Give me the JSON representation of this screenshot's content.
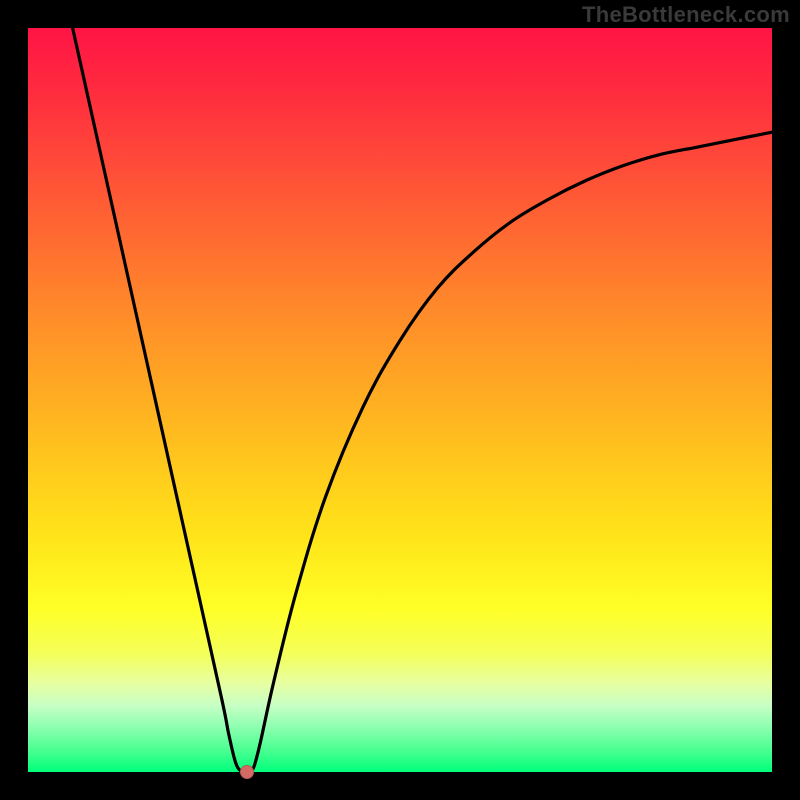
{
  "watermark": {
    "text": "TheBottleneck.com"
  },
  "chart_data": {
    "type": "line",
    "title": "",
    "xlabel": "",
    "ylabel": "",
    "xlim": [
      0,
      100
    ],
    "ylim": [
      0,
      100
    ],
    "grid": false,
    "legend": false,
    "series": [
      {
        "name": "bottleneck-curve",
        "color": "#000000",
        "x": [
          6,
          10,
          14,
          18,
          22,
          26,
          27,
          28,
          29,
          30,
          31,
          33,
          36,
          40,
          45,
          50,
          55,
          60,
          65,
          70,
          75,
          80,
          85,
          90,
          95,
          100
        ],
        "y": [
          100,
          82,
          64,
          46,
          28,
          10,
          5,
          1,
          0,
          0,
          3,
          12,
          24,
          37,
          49,
          58,
          65,
          70,
          74,
          77,
          79.5,
          81.5,
          83,
          84,
          85,
          86
        ]
      }
    ],
    "marker": {
      "x": 29.5,
      "y": 0,
      "color": "#d46a64"
    },
    "background_gradient": {
      "direction": "vertical",
      "stops": [
        {
          "pos": 0.0,
          "color": "#ff1445"
        },
        {
          "pos": 0.5,
          "color": "#ffb020"
        },
        {
          "pos": 0.78,
          "color": "#ffff26"
        },
        {
          "pos": 1.0,
          "color": "#00ff7a"
        }
      ]
    }
  }
}
